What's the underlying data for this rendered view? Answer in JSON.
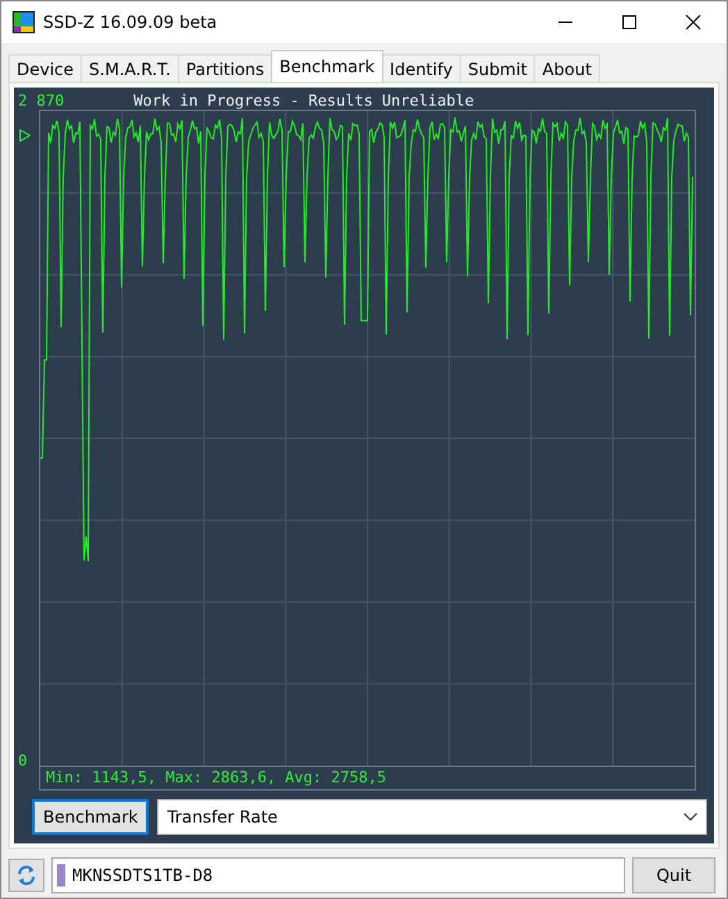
{
  "window": {
    "title": "SSD-Z 16.09.09 beta"
  },
  "tabs": [
    {
      "label": "Device",
      "selected": false
    },
    {
      "label": "S.M.A.R.T.",
      "selected": false
    },
    {
      "label": "Partitions",
      "selected": false
    },
    {
      "label": "Benchmark",
      "selected": true
    },
    {
      "label": "Identify",
      "selected": false
    },
    {
      "label": "Submit",
      "selected": false
    },
    {
      "label": "About",
      "selected": false
    }
  ],
  "graph": {
    "title": "Work in Progress - Results Unreliable",
    "y_max_label": "2 870",
    "y_min_label": "0",
    "stats": "Min: 1143,5, Max: 2863,6, Avg: 2758,5"
  },
  "controls": {
    "button": "Benchmark",
    "mode": "Transfer Rate"
  },
  "status_bar": {
    "drive": "MKNSSDTS1TB-D8",
    "quit": "Quit"
  }
}
